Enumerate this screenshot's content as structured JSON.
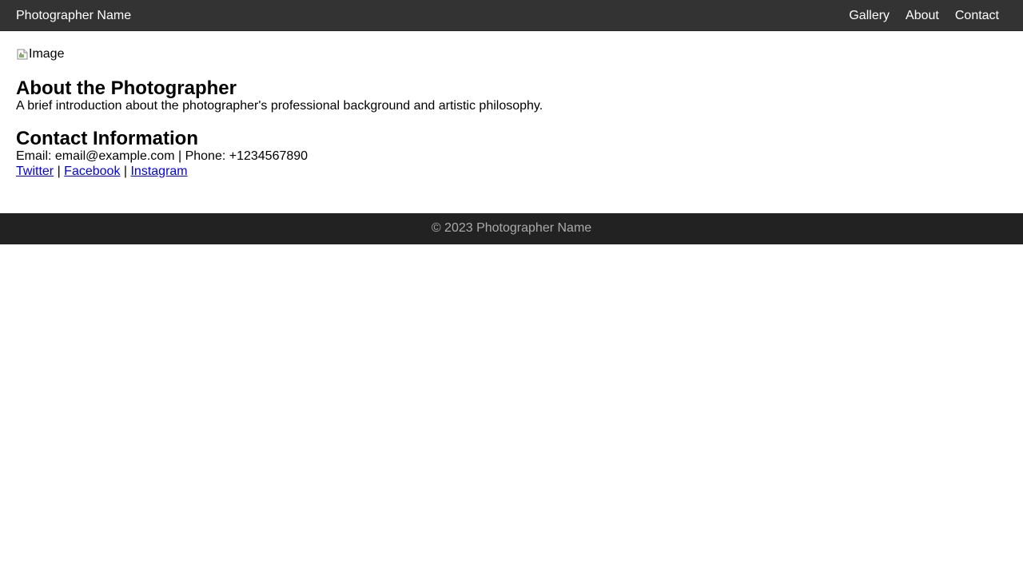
{
  "header": {
    "brand": "Photographer Name",
    "nav": [
      {
        "label": "Gallery"
      },
      {
        "label": "About"
      },
      {
        "label": "Contact"
      }
    ]
  },
  "main": {
    "image": {
      "alt": "Image",
      "icon": "broken-image-icon"
    },
    "about": {
      "title": "About the Photographer",
      "text": "A brief introduction about the photographer's professional background and artistic philosophy."
    },
    "contact": {
      "title": "Contact Information",
      "details": "Email: email@example.com | Phone: +1234567890",
      "social": [
        {
          "label": "Twitter"
        },
        {
          "label": "Facebook"
        },
        {
          "label": "Instagram"
        }
      ],
      "separator": " | "
    }
  },
  "footer": {
    "text": "© 2023 Photographer Name"
  },
  "colors": {
    "header_bg": "#333333",
    "footer_bg": "#222222",
    "footer_text": "#aaaaaa",
    "link": "#0000ee"
  }
}
